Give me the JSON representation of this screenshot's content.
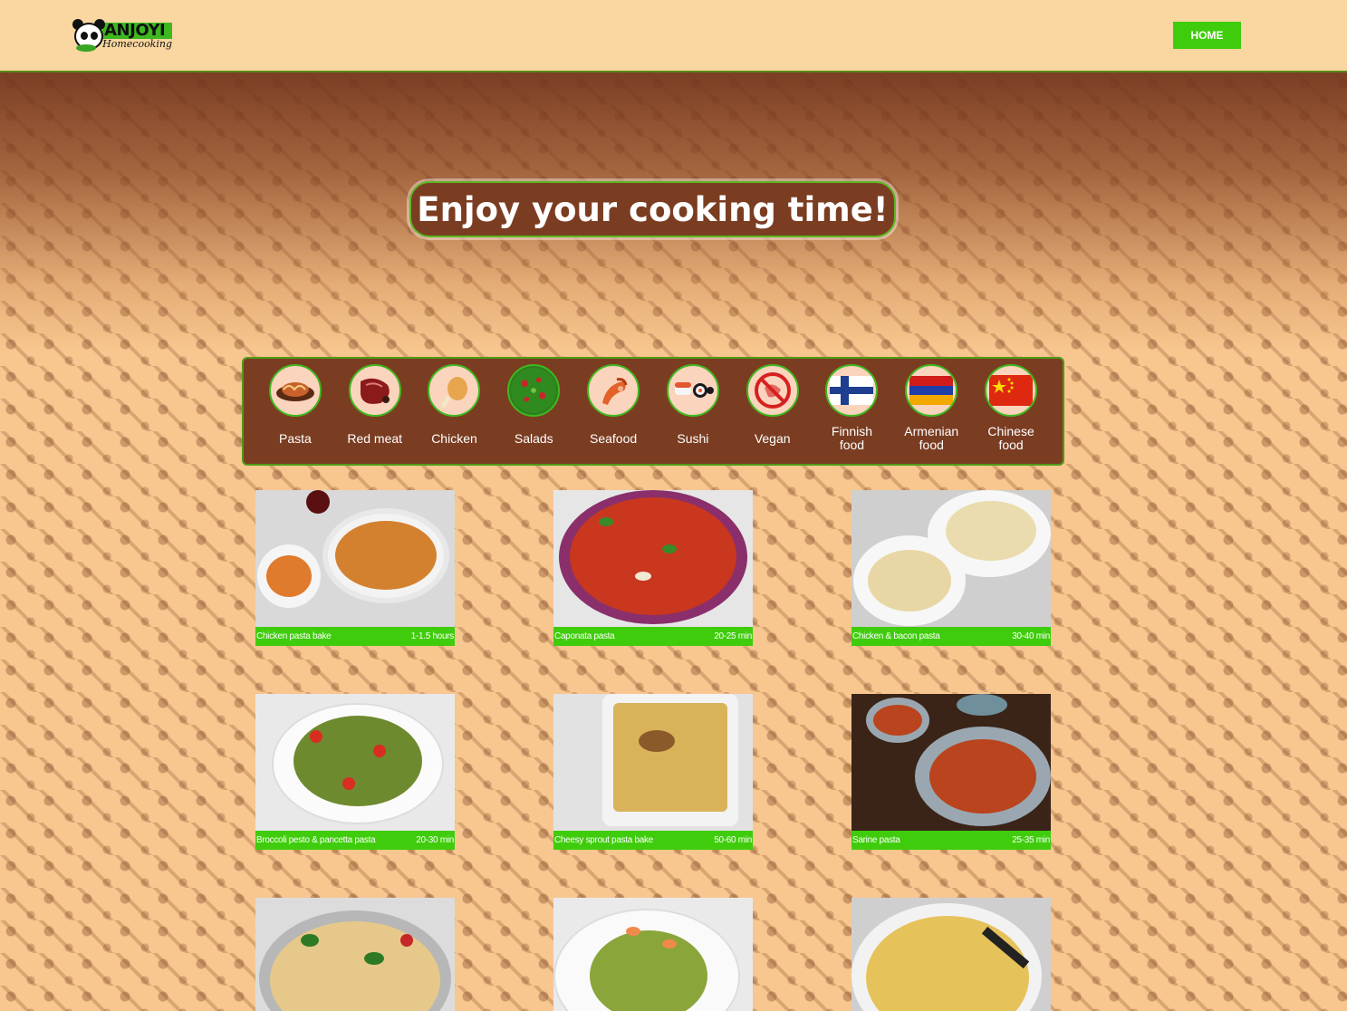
{
  "header": {
    "logo_title": "ANJOYI",
    "logo_sub": "Homecooking",
    "home_label": "HOME"
  },
  "hero": {
    "title": "Enjoy your cooking time!"
  },
  "categories": [
    {
      "label": "Pasta",
      "icon": "pasta-icon"
    },
    {
      "label": "Red meat",
      "icon": "steak-icon"
    },
    {
      "label": "Chicken",
      "icon": "chicken-leg-icon"
    },
    {
      "label": "Salads",
      "icon": "salad-icon"
    },
    {
      "label": "Seafood",
      "icon": "shrimp-icon"
    },
    {
      "label": "Sushi",
      "icon": "sushi-icon"
    },
    {
      "label": "Vegan",
      "icon": "no-meat-icon"
    },
    {
      "label": "Finnish food",
      "icon": "finland-flag-icon"
    },
    {
      "label": "Armenian food",
      "icon": "armenia-flag-icon"
    },
    {
      "label": "Chinese food",
      "icon": "china-flag-icon"
    }
  ],
  "recipes": [
    {
      "name": "Chicken pasta bake",
      "time": "1-1.5 hours"
    },
    {
      "name": "Caponata pasta",
      "time": "20-25 min"
    },
    {
      "name": "Chicken & bacon pasta",
      "time": "30-40 min"
    },
    {
      "name": "Broccoli pesto & pancetta pasta",
      "time": "20-30 min"
    },
    {
      "name": "Cheesy sprout pasta bake",
      "time": "50-60 min"
    },
    {
      "name": "Sarine pasta",
      "time": "25-35 min"
    },
    {
      "name": "",
      "time": ""
    },
    {
      "name": "",
      "time": ""
    },
    {
      "name": "",
      "time": ""
    }
  ],
  "colors": {
    "accent_green": "#3fcc0c",
    "brown": "#7b3d22",
    "header_bg": "#fad6a0",
    "page_bg": "#f8c78f"
  }
}
